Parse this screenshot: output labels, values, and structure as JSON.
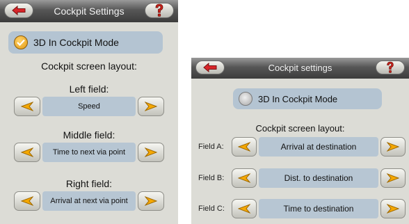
{
  "left": {
    "title": "Cockpit Settings",
    "toggle": {
      "label": "3D In Cockpit Mode",
      "checked": true
    },
    "layout_heading": "Cockpit screen layout:",
    "fields": [
      {
        "label": "Left field:",
        "value": "Speed"
      },
      {
        "label": "Middle field:",
        "value": "Time to next via point"
      },
      {
        "label": "Right field:",
        "value": "Arrival at next via point"
      }
    ]
  },
  "right": {
    "title": "Cockpit settings",
    "toggle": {
      "label": "3D In Cockpit Mode",
      "checked": false
    },
    "layout_heading": "Cockpit screen layout:",
    "fields": [
      {
        "label": "Field A:",
        "value": "Arrival at destination"
      },
      {
        "label": "Field B:",
        "value": "Dist. to destination"
      },
      {
        "label": "Field C:",
        "value": "Time to destination"
      }
    ]
  },
  "icons": {
    "back": "back-arrow-icon",
    "help": "question-mark-icon",
    "prev": "left-arrow-icon",
    "next": "right-arrow-icon"
  },
  "colors": {
    "panel_bg": "#dcdcd6",
    "titlebar": "#4a4a4a",
    "field_bg": "#b7c6d3",
    "arrow_orange": "#f5a800",
    "help_red": "#c8221a"
  }
}
